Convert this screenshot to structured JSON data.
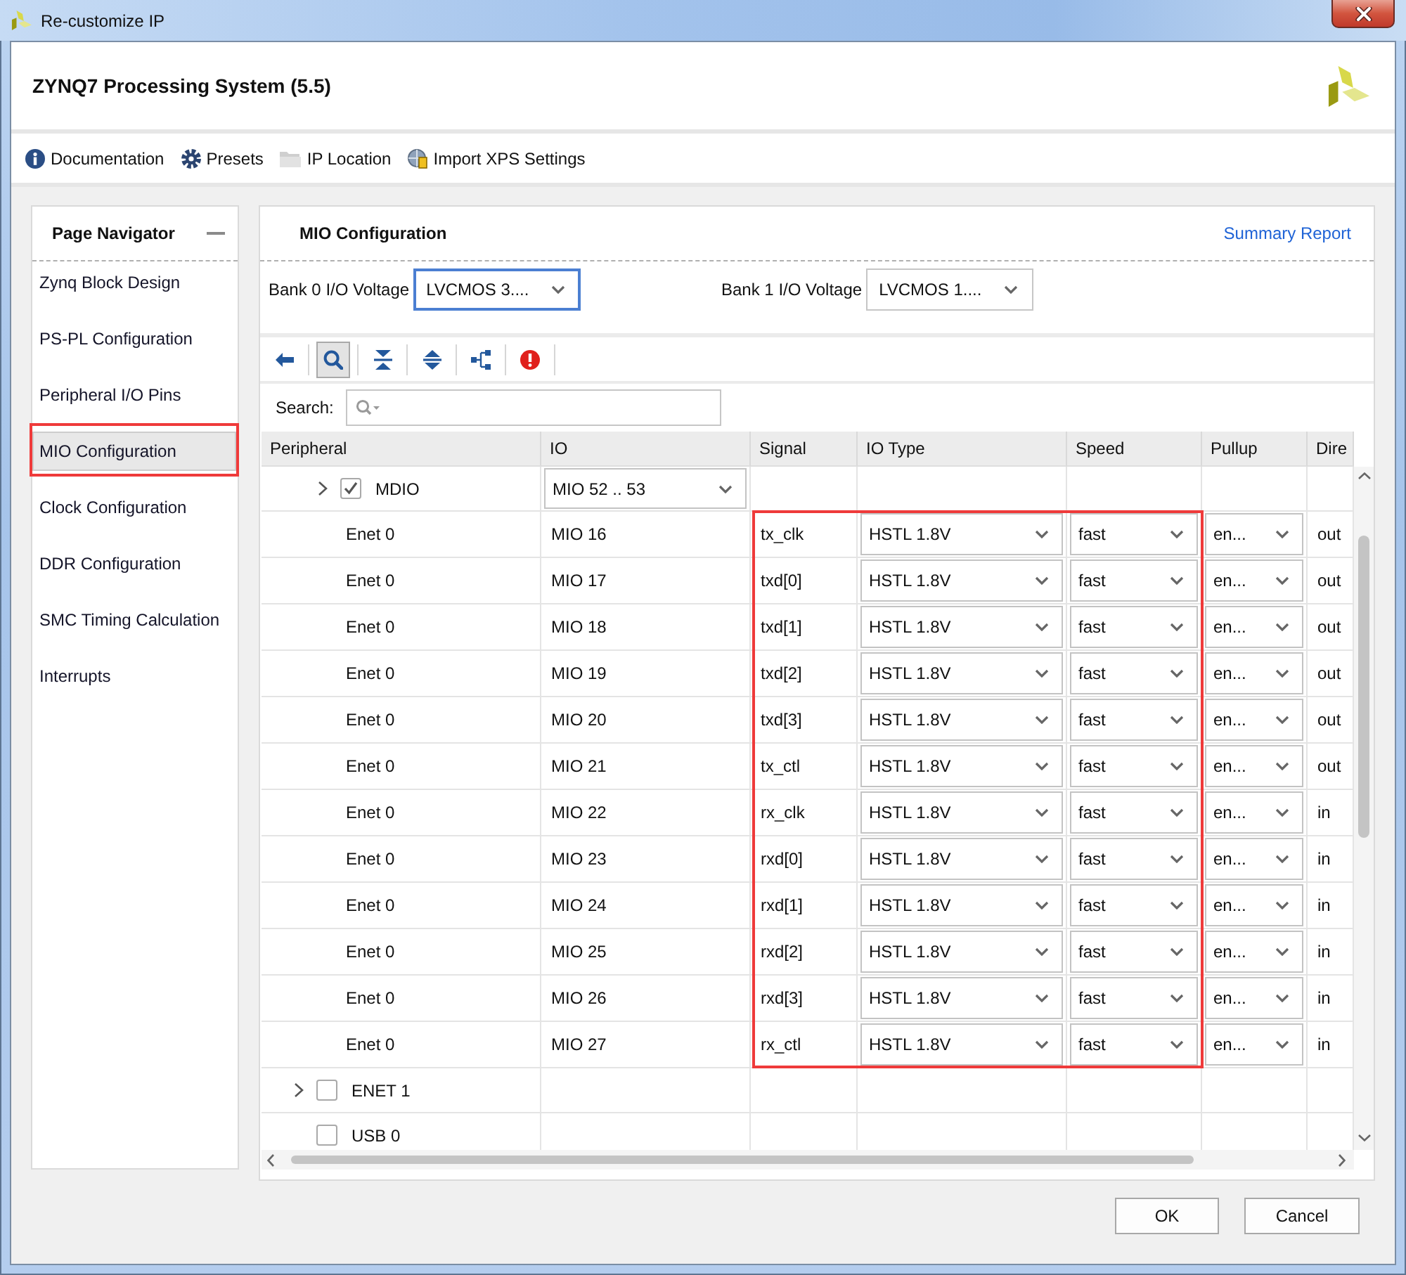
{
  "window": {
    "title": "Re-customize IP"
  },
  "header": {
    "title": "ZYNQ7 Processing System (5.5)"
  },
  "toolbar": [
    {
      "kind": "info",
      "label": "Documentation"
    },
    {
      "kind": "gear",
      "label": "Presets"
    },
    {
      "kind": "folder",
      "label": "IP Location"
    },
    {
      "kind": "globe",
      "label": "Import XPS Settings"
    }
  ],
  "navigator": {
    "title": "Page Navigator",
    "items": [
      {
        "label": "Zynq Block Design",
        "selected": false,
        "highlighted": false
      },
      {
        "label": "PS-PL Configuration",
        "selected": false,
        "highlighted": false
      },
      {
        "label": "Peripheral I/O Pins",
        "selected": false,
        "highlighted": false
      },
      {
        "label": "MIO Configuration",
        "selected": true,
        "highlighted": true
      },
      {
        "label": "Clock Configuration",
        "selected": false,
        "highlighted": false
      },
      {
        "label": "DDR Configuration",
        "selected": false,
        "highlighted": false
      },
      {
        "label": "SMC Timing Calculation",
        "selected": false,
        "highlighted": false
      },
      {
        "label": "Interrupts",
        "selected": false,
        "highlighted": false
      }
    ]
  },
  "page": {
    "title": "MIO Configuration",
    "link": "Summary Report",
    "voltages": [
      {
        "label": "Bank 0 I/O Voltage",
        "value": "LVCMOS 3....",
        "focused": true
      },
      {
        "label": "Bank 1 I/O Voltage",
        "value": "LVCMOS 1....",
        "focused": false
      }
    ],
    "tools": [
      {
        "kind": "back",
        "selected": false
      },
      {
        "kind": "search",
        "selected": true
      },
      {
        "kind": "collapse_all",
        "selected": false
      },
      {
        "kind": "expand_all",
        "selected": false
      },
      {
        "kind": "hierarchy",
        "selected": false
      },
      {
        "kind": "error",
        "selected": false
      }
    ],
    "search": {
      "label": "Search:"
    },
    "table": {
      "columns": [
        "Peripheral",
        "IO",
        "Signal",
        "IO Type",
        "Speed",
        "Pullup",
        "Dire"
      ],
      "rows": [
        {
          "kind": "continued",
          "children": [
            {
              "kind": "group",
              "peripheral": "MDIO",
              "expanded": false,
              "checked": true,
              "cells": [
                {
                  "kind": "dropdown",
                  "value": "MIO 52 .. 53"
                }
              ]
            },
            {
              "kind": "pin",
              "peripheral": "Enet 0",
              "cells": [
                {
                  "kind": "text",
                  "text": "MIO 16"
                },
                {
                  "kind": "framed",
                  "cells": [
                    {
                      "kind": "text",
                      "text": "tx_clk"
                    },
                    {
                      "kind": "dropdown",
                      "value": "HSTL 1.8V"
                    },
                    {
                      "kind": "dropdown",
                      "value": "fast"
                    }
                  ]
                },
                {
                  "kind": "dropdown",
                  "value": "en..."
                },
                {
                  "kind": "text",
                  "text": "out"
                }
              ]
            },
            {
              "kind": "pin",
              "peripheral": "Enet 0",
              "cells": [
                {
                  "kind": "text",
                  "text": "MIO 17"
                },
                {
                  "kind": "framed",
                  "cells": [
                    {
                      "kind": "text",
                      "text": "txd[0]"
                    },
                    {
                      "kind": "dropdown",
                      "value": "HSTL 1.8V"
                    },
                    {
                      "kind": "dropdown",
                      "value": "fast"
                    }
                  ]
                },
                {
                  "kind": "dropdown",
                  "value": "en..."
                },
                {
                  "kind": "text",
                  "text": "out"
                }
              ]
            },
            {
              "kind": "pin",
              "peripheral": "Enet 0",
              "cells": [
                {
                  "kind": "text",
                  "text": "MIO 18"
                },
                {
                  "kind": "framed",
                  "cells": [
                    {
                      "kind": "text",
                      "text": "txd[1]"
                    },
                    {
                      "kind": "dropdown",
                      "value": "HSTL 1.8V"
                    },
                    {
                      "kind": "dropdown",
                      "value": "fast"
                    }
                  ]
                },
                {
                  "kind": "dropdown",
                  "value": "en..."
                },
                {
                  "kind": "text",
                  "text": "out"
                }
              ]
            },
            {
              "kind": "pin",
              "peripheral": "Enet 0",
              "cells": [
                {
                  "kind": "text",
                  "text": "MIO 19"
                },
                {
                  "kind": "framed",
                  "cells": [
                    {
                      "kind": "text",
                      "text": "txd[2]"
                    },
                    {
                      "kind": "dropdown",
                      "value": "HSTL 1.8V"
                    },
                    {
                      "kind": "dropdown",
                      "value": "fast"
                    }
                  ]
                },
                {
                  "kind": "dropdown",
                  "value": "en..."
                },
                {
                  "kind": "text",
                  "text": "out"
                }
              ]
            },
            {
              "kind": "pin",
              "peripheral": "Enet 0",
              "cells": [
                {
                  "kind": "text",
                  "text": "MIO 20"
                },
                {
                  "kind": "framed",
                  "cells": [
                    {
                      "kind": "text",
                      "text": "txd[3]"
                    },
                    {
                      "kind": "dropdown",
                      "value": "HSTL 1.8V"
                    },
                    {
                      "kind": "dropdown",
                      "value": "fast"
                    }
                  ]
                },
                {
                  "kind": "dropdown",
                  "value": "en..."
                },
                {
                  "kind": "text",
                  "text": "out"
                }
              ]
            },
            {
              "kind": "pin",
              "peripheral": "Enet 0",
              "cells": [
                {
                  "kind": "text",
                  "text": "MIO 21"
                },
                {
                  "kind": "framed",
                  "cells": [
                    {
                      "kind": "text",
                      "text": "tx_ctl"
                    },
                    {
                      "kind": "dropdown",
                      "value": "HSTL 1.8V"
                    },
                    {
                      "kind": "dropdown",
                      "value": "fast"
                    }
                  ]
                },
                {
                  "kind": "dropdown",
                  "value": "en..."
                },
                {
                  "kind": "text",
                  "text": "out"
                }
              ]
            },
            {
              "kind": "pin",
              "peripheral": "Enet 0",
              "cells": [
                {
                  "kind": "text",
                  "text": "MIO 22"
                },
                {
                  "kind": "framed",
                  "cells": [
                    {
                      "kind": "text",
                      "text": "rx_clk"
                    },
                    {
                      "kind": "dropdown",
                      "value": "HSTL 1.8V"
                    },
                    {
                      "kind": "dropdown",
                      "value": "fast"
                    }
                  ]
                },
                {
                  "kind": "dropdown",
                  "value": "en..."
                },
                {
                  "kind": "text",
                  "text": "in"
                }
              ]
            },
            {
              "kind": "pin",
              "peripheral": "Enet 0",
              "cells": [
                {
                  "kind": "text",
                  "text": "MIO 23"
                },
                {
                  "kind": "framed",
                  "cells": [
                    {
                      "kind": "text",
                      "text": "rxd[0]"
                    },
                    {
                      "kind": "dropdown",
                      "value": "HSTL 1.8V"
                    },
                    {
                      "kind": "dropdown",
                      "value": "fast"
                    }
                  ]
                },
                {
                  "kind": "dropdown",
                  "value": "en..."
                },
                {
                  "kind": "text",
                  "text": "in"
                }
              ]
            },
            {
              "kind": "pin",
              "peripheral": "Enet 0",
              "cells": [
                {
                  "kind": "text",
                  "text": "MIO 24"
                },
                {
                  "kind": "framed",
                  "cells": [
                    {
                      "kind": "text",
                      "text": "rxd[1]"
                    },
                    {
                      "kind": "dropdown",
                      "value": "HSTL 1.8V"
                    },
                    {
                      "kind": "dropdown",
                      "value": "fast"
                    }
                  ]
                },
                {
                  "kind": "dropdown",
                  "value": "en..."
                },
                {
                  "kind": "text",
                  "text": "in"
                }
              ]
            },
            {
              "kind": "pin",
              "peripheral": "Enet 0",
              "cells": [
                {
                  "kind": "text",
                  "text": "MIO 25"
                },
                {
                  "kind": "framed",
                  "cells": [
                    {
                      "kind": "text",
                      "text": "rxd[2]"
                    },
                    {
                      "kind": "dropdown",
                      "value": "HSTL 1.8V"
                    },
                    {
                      "kind": "dropdown",
                      "value": "fast"
                    }
                  ]
                },
                {
                  "kind": "dropdown",
                  "value": "en..."
                },
                {
                  "kind": "text",
                  "text": "in"
                }
              ]
            },
            {
              "kind": "pin",
              "peripheral": "Enet 0",
              "cells": [
                {
                  "kind": "text",
                  "text": "MIO 26"
                },
                {
                  "kind": "framed",
                  "cells": [
                    {
                      "kind": "text",
                      "text": "rxd[3]"
                    },
                    {
                      "kind": "dropdown",
                      "value": "HSTL 1.8V"
                    },
                    {
                      "kind": "dropdown",
                      "value": "fast"
                    }
                  ]
                },
                {
                  "kind": "dropdown",
                  "value": "en..."
                },
                {
                  "kind": "text",
                  "text": "in"
                }
              ]
            },
            {
              "kind": "pin",
              "peripheral": "Enet 0",
              "cells": [
                {
                  "kind": "text",
                  "text": "MIO 27"
                },
                {
                  "kind": "framed",
                  "cells": [
                    {
                      "kind": "text",
                      "text": "rx_ctl"
                    },
                    {
                      "kind": "dropdown",
                      "value": "HSTL 1.8V"
                    },
                    {
                      "kind": "dropdown",
                      "value": "fast"
                    }
                  ]
                },
                {
                  "kind": "dropdown",
                  "value": "en..."
                },
                {
                  "kind": "text",
                  "text": "in"
                }
              ]
            }
          ]
        },
        {
          "kind": "group",
          "peripheral": "ENET 1",
          "expanded": false,
          "checked": false
        },
        {
          "kind": "group",
          "peripheral": "USB 0",
          "checked": false
        }
      ]
    }
  },
  "buttons": [
    "OK",
    "Cancel"
  ]
}
